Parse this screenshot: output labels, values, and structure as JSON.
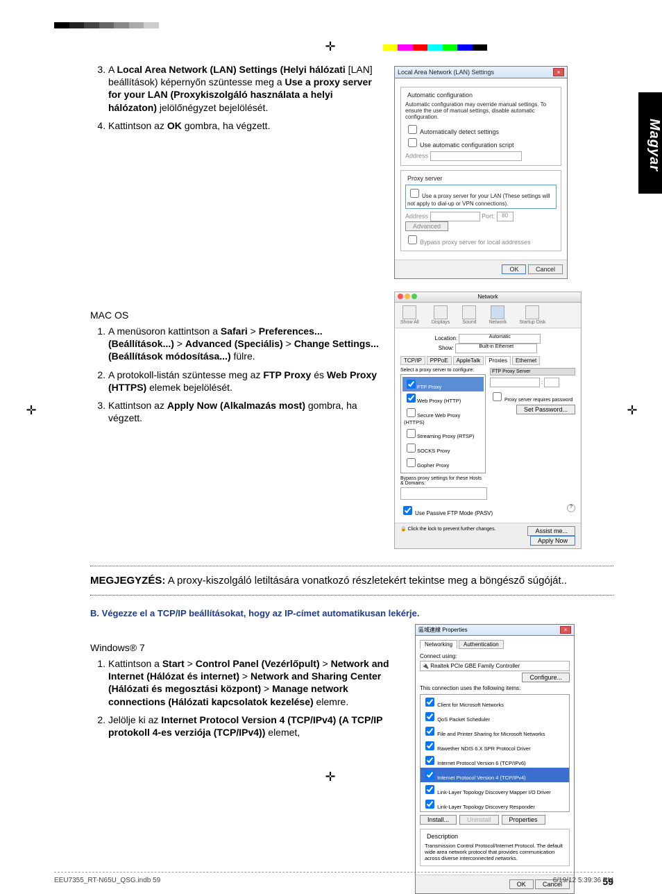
{
  "language_tab": "Magyar",
  "page_number": "59",
  "footer": {
    "left": "EEU7355_RT-N65U_QSG.indb   59",
    "right": "6/19/12   5:39:36 PM"
  },
  "colorbar_left": [
    "#000",
    "#222",
    "#444",
    "#666",
    "#888",
    "#aaa",
    "#ccc",
    "#fff",
    "#fff",
    "#fff",
    "#fff",
    "#fff",
    "#fff"
  ],
  "colorbar_right": [
    "#fff",
    "#ff0",
    "#f0f",
    "#f00",
    "#0ff",
    "#0f0",
    "#00f",
    "#000",
    "#fff",
    "#fff",
    "#fff",
    "#fff",
    "#fff"
  ],
  "block1": {
    "start": "3",
    "items": [
      {
        "before": "A ",
        "b1": "Local Area Network (LAN) Settings (Helyi hálózati",
        "mid1": " [LAN] beállítások) képernyőn szüntesse meg a ",
        "b2": "Use a proxy server for your LAN (Proxykiszolgáló használata a helyi hálózaton)",
        "after": " jelölőnégyzet bejelölését."
      },
      {
        "before": "Kattintson az ",
        "b1": "OK",
        "after": " gombra, ha végzett."
      }
    ]
  },
  "macos_label": "MAC OS",
  "block2": {
    "items": [
      {
        "pre": "A menüsoron kattintson a ",
        "b1": "Safari",
        "gt1": " > ",
        "b2": "Preferences... (Beállítások...)",
        "gt2": " > ",
        "b3": "Advanced (Speciális)",
        "gt3": " > ",
        "b4": "Change Settings...(Beállítások módosítása...)",
        "post": " fülre."
      },
      {
        "pre": "A protokoll-listán szüntesse meg az ",
        "b1": "FTP Proxy",
        "mid": " és ",
        "b2": "Web Proxy (HTTPS)",
        "post": " elemek bejelölését."
      },
      {
        "pre": "Kattintson az ",
        "b1": "Apply Now (Alkalmazás most)",
        "post": " gombra, ha végzett."
      }
    ]
  },
  "note": {
    "label": "MEGJEGYZÉS:",
    "text": "   A proxy-kiszolgáló letiltására vonatkozó részletekért tekintse meg a böngésző súgóját.."
  },
  "sectionB": {
    "title": "B.   Végezze el a TCP/IP beállításokat, hogy az IP-címet automatikusan lekérje."
  },
  "windows7_label": "Windows® 7",
  "block3": {
    "items": [
      {
        "pre": "Kattintson a ",
        "b1": "Start",
        "gt1": " > ",
        "b2": "Control Panel (Vezérlőpult)",
        "gt2": " > ",
        "b3": "Network and Internet (Hálózat és internet)",
        "gt3": " > ",
        "b4": "Network and Sharing Center (Hálózati és megosztási központ)",
        "gt4": " > ",
        "b5": "Manage network connections (Hálózati kapcsolatok kezelése)",
        "post": " elemre."
      },
      {
        "pre": "Jelölje ki az ",
        "b1": "Internet Protocol Version 4 (TCP/IPv4) (A TCP/IP protokoll 4-es verziója (TCP/IPv4))",
        "post": " elemet,"
      }
    ]
  },
  "lan_window": {
    "title": "Local Area Network (LAN) Settings",
    "auto_group": "Automatic configuration",
    "auto_text": "Automatic configuration may override manual settings. To ensure the use of manual settings, disable automatic configuration.",
    "chk1": "Automatically detect settings",
    "chk2": "Use automatic configuration script",
    "addr": "Address",
    "proxy_group": "Proxy server",
    "proxy_chk": "Use a proxy server for your LAN (These settings will not apply to dial-up or VPN connections).",
    "port": "Port:",
    "port_val": "80",
    "adv": "Advanced",
    "bypass": "Bypass proxy server for local addresses",
    "ok": "OK",
    "cancel": "Cancel"
  },
  "mac_window": {
    "title": "Network",
    "toolbar": [
      "Show All",
      "Displays",
      "Sound",
      "Network",
      "Startup Disk"
    ],
    "loc": "Location:",
    "loc_val": "Automatic",
    "show": "Show:",
    "show_val": "Built-in Ethernet",
    "tabs": [
      "TCP/IP",
      "PPPoE",
      "AppleTalk",
      "Proxies",
      "Ethernet"
    ],
    "select": "Select a proxy server to configure:",
    "ftp_header": "FTP Proxy Server",
    "list": [
      "FTP Proxy",
      "Web Proxy (HTTP)",
      "Secure Web Proxy (HTTPS)",
      "Streaming Proxy (RTSP)",
      "SOCKS Proxy",
      "Gopher Proxy"
    ],
    "req": "Proxy server requires password",
    "setpw": "Set Password...",
    "bypass": "Bypass proxy settings for these Hosts & Domains:",
    "pasv": "Use Passive FTP Mode (PASV)",
    "lock": "Click the lock to prevent further changes.",
    "assist": "Assist me...",
    "apply": "Apply Now"
  },
  "w7_window": {
    "title": "區域連線 Properties",
    "tabs": [
      "Networking",
      "Authentication"
    ],
    "connect": "Connect using:",
    "adapter": "Realtek PCIe GBE Family Controller",
    "configure": "Configure...",
    "uses": "This connection uses the following items:",
    "list": [
      "Client for Microsoft Networks",
      "QoS Packet Scheduler",
      "File and Printer Sharing for Microsoft Networks",
      "Rawether NDIS 6.X SPR Protocol Driver",
      "Internet Protocol Version 6 (TCP/IPv6)",
      "Internet Protocol Version 4 (TCP/IPv4)",
      "Link-Layer Topology Discovery Mapper I/O Driver",
      "Link-Layer Topology Discovery Responder"
    ],
    "install": "Install...",
    "uninstall": "Uninstall",
    "props": "Properties",
    "desc_label": "Description",
    "desc": "Transmission Control Protocol/Internet Protocol. The default wide area network protocol that provides communication across diverse interconnected networks.",
    "ok": "OK",
    "cancel": "Cancel"
  }
}
